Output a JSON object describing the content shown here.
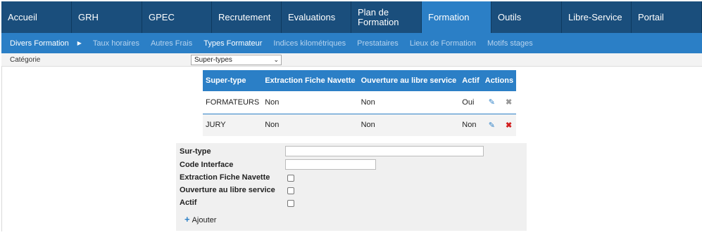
{
  "topnav": {
    "tabs": [
      {
        "label": "Accueil",
        "active": false
      },
      {
        "label": "GRH",
        "active": false
      },
      {
        "label": "GPEC",
        "active": false
      },
      {
        "label": "Recrutement",
        "active": false
      },
      {
        "label": "Evaluations",
        "active": false
      },
      {
        "label": "Plan de Formation",
        "active": false
      },
      {
        "label": "Formation",
        "active": true
      },
      {
        "label": "Outils",
        "active": false
      },
      {
        "label": "Libre-Service",
        "active": false
      },
      {
        "label": "Portail",
        "active": false
      }
    ]
  },
  "subnav": {
    "items": [
      {
        "label": "Divers Formation",
        "current": true
      },
      {
        "label": "Taux horaires",
        "current": false
      },
      {
        "label": "Autres Frais",
        "current": false
      },
      {
        "label": "Types Formateur",
        "current": true
      },
      {
        "label": "Indices kilométriques",
        "current": false
      },
      {
        "label": "Prestataires",
        "current": false
      },
      {
        "label": "Lieux de Formation",
        "current": false
      },
      {
        "label": "Motifs stages",
        "current": false
      }
    ]
  },
  "category": {
    "label": "Catégorie",
    "selected": "Super-types"
  },
  "table": {
    "headers": [
      "Super-type",
      "Extraction Fiche Navette",
      "Ouverture au libre service",
      "Actif",
      "Actions"
    ],
    "rows": [
      {
        "super_type": "FORMATEURS",
        "extraction": "Non",
        "ouverture": "Non",
        "actif": "Oui"
      },
      {
        "super_type": "JURY",
        "extraction": "Non",
        "ouverture": "Non",
        "actif": "Non"
      }
    ]
  },
  "form": {
    "sur_type_label": "Sur-type",
    "code_interface_label": "Code Interface",
    "extraction_label": "Extraction Fiche Navette",
    "ouverture_label": "Ouverture au libre service",
    "actif_label": "Actif",
    "add_label": "Ajouter"
  },
  "colors": {
    "nav_dark": "#1a4e7c",
    "nav_accent": "#2b7fc6",
    "delete_red": "#d21f1f"
  }
}
